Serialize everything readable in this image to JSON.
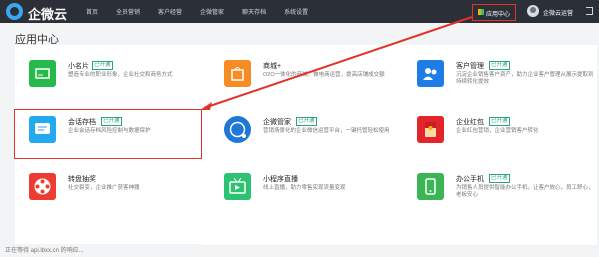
{
  "header": {
    "brand": "企微云",
    "nav": [
      "首页",
      "全员营销",
      "客户经营",
      "企微管家",
      "聊天存档",
      "系统设置"
    ],
    "app_center": "应用中心",
    "user_name": "企微云运营"
  },
  "page_title": "应用中心",
  "cards": [
    {
      "name": "小名片",
      "badge": "已开通",
      "desc": "塑造专业的职业形象，企业社交和商务方式",
      "icon": "card-icon",
      "color": "#27b94c"
    },
    {
      "name": "商城+",
      "badge": "",
      "desc": "O2O一体化的商城，做电商运营，提高店铺成交额",
      "icon": "shop-bag-icon",
      "color": "#f78c25"
    },
    {
      "name": "客户管理",
      "badge": "已开通",
      "desc": "沉淀企业销售客户资产，助力企业客户管理从展示提取到持续转化提效",
      "icon": "customer-icon",
      "color": "#1e7ce6"
    },
    {
      "name": "会话存档",
      "badge": "已开通",
      "desc": "企业会话存档风险控制与数据保护",
      "icon": "chat-archive-icon",
      "color": "#23a9ee"
    },
    {
      "name": "企微管家",
      "badge": "已开通",
      "desc": "营销场景化的企业微信运营平台，一键托管轻松使用",
      "icon": "assistant-icon",
      "color": "#1e78d8"
    },
    {
      "name": "企业红包",
      "badge": "已开通",
      "desc": "企业红包营销，企业营销客户转化",
      "icon": "red-packet-icon",
      "color": "#e3252b"
    },
    {
      "name": "转盘抽奖",
      "badge": "",
      "desc": "社交裂变，企业推广获客神器",
      "icon": "wheel-icon",
      "color": "#ee3c33"
    },
    {
      "name": "小程序直播",
      "badge": "",
      "desc": "线上直播，助力零售实现流量变现",
      "icon": "live-tv-icon",
      "color": "#2bc272"
    },
    {
      "name": "办公手机",
      "badge": "已开通",
      "desc": "为销售人员提供智能办公手机，让客户放心，员工舒心，老板安心",
      "icon": "phone-icon",
      "color": "#3bb556"
    }
  ],
  "status_bar": "正在等待 api.lbxx.cn 的响应..."
}
